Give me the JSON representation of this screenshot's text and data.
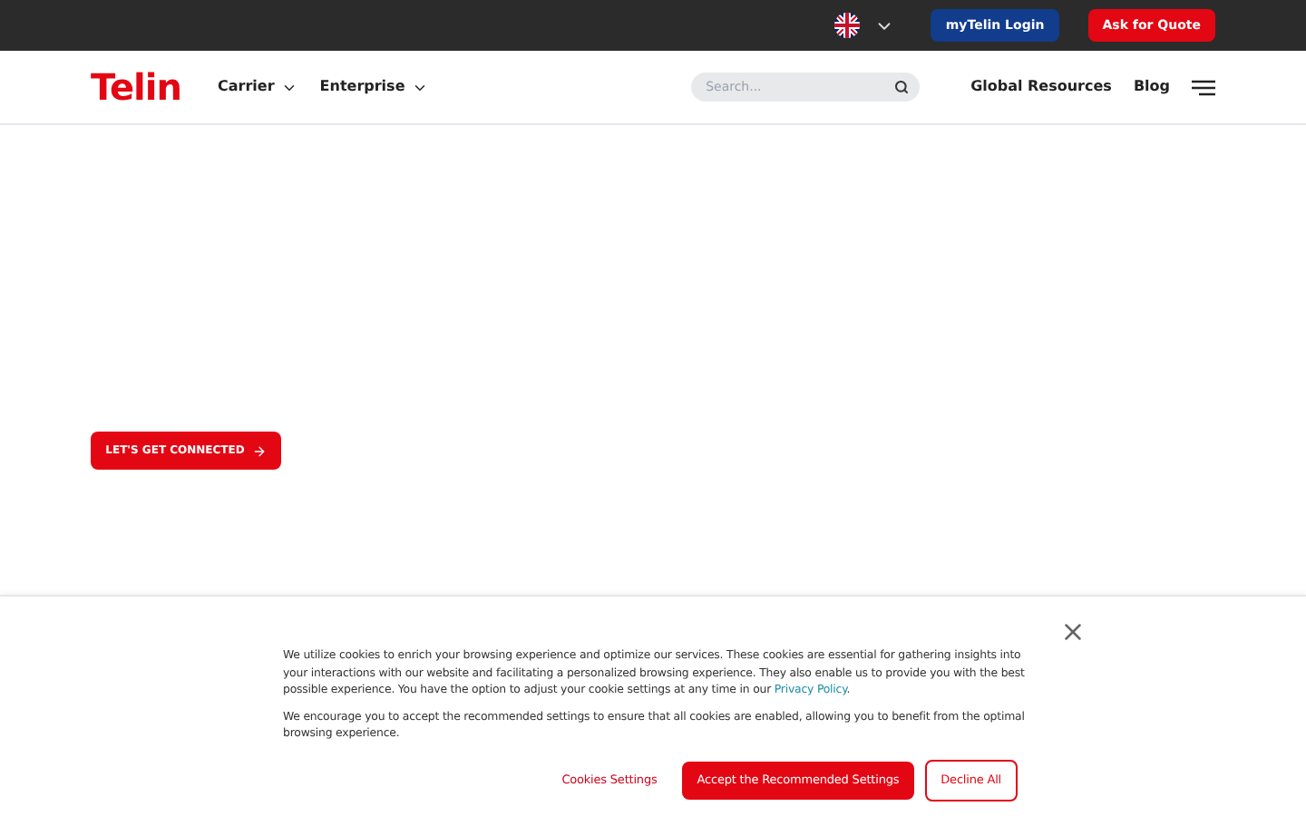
{
  "top_bar": {
    "login_button": "myTelin Login",
    "quote_button": "Ask for Quote"
  },
  "header": {
    "logo": "Telin",
    "nav": [
      {
        "label": "Carrier"
      },
      {
        "label": "Enterprise"
      }
    ],
    "search": {
      "placeholder": "Search..."
    },
    "links": [
      "Global Resources",
      "Blog"
    ]
  },
  "hero": {
    "cta": "LET'S GET CONNECTED"
  },
  "cookie_banner": {
    "paragraph_1": {
      "text": "We utilize cookies to enrich your browsing experience and optimize our services. These cookies are essential for gathering insights into your interactions with our website and facilitating a personalized browsing experience. They also enable us to provide you with the best possible experience. You have the option to adjust your cookie settings at any time in our ",
      "link": "Privacy Policy",
      "after": "."
    },
    "paragraph_2": "We encourage you to accept the recommended settings to ensure that all cookies are enabled, allowing you to benefit from the optimal browsing experience.",
    "buttons": [
      {
        "label": "Cookies Settings",
        "kind": "text"
      },
      {
        "label": "Accept the Recommended Settings",
        "kind": "primary"
      },
      {
        "label": "Decline All",
        "kind": "outline"
      }
    ]
  }
}
